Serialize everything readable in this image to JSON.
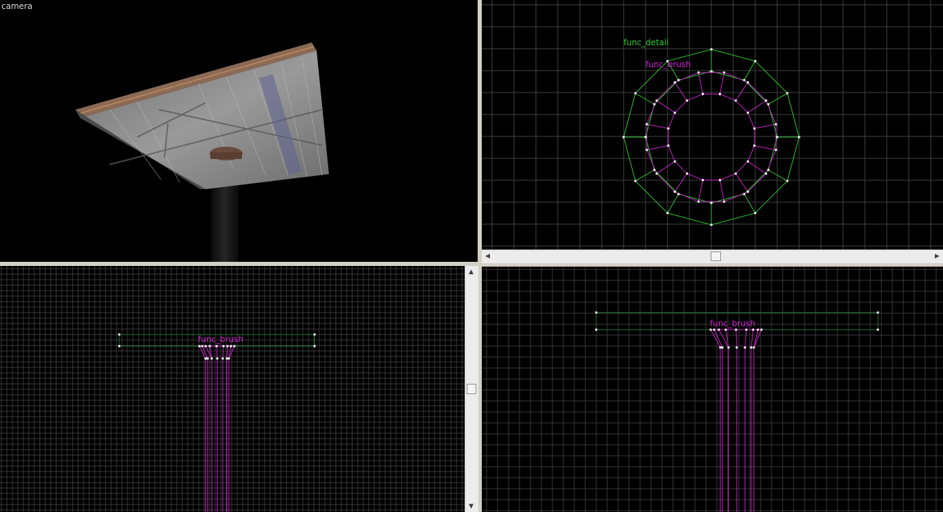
{
  "camera_view": {
    "label": "camera"
  },
  "top_view": {
    "entity_outer": "func_detail",
    "entity_inner": "func_brush"
  },
  "side_view": {
    "entity": "func_brush"
  },
  "front_view": {
    "entity": "func_brush"
  },
  "colors": {
    "grid": "#3c3c3c",
    "detail": "#2ccf2c",
    "brush": "#d020d0",
    "handle": "#ffffff",
    "background": "#000000"
  },
  "icons": {
    "scroll_left": "arrow-left-icon",
    "scroll_right": "arrow-right-icon",
    "scroll_up": "arrow-up-icon",
    "scroll_down": "arrow-down-icon"
  }
}
